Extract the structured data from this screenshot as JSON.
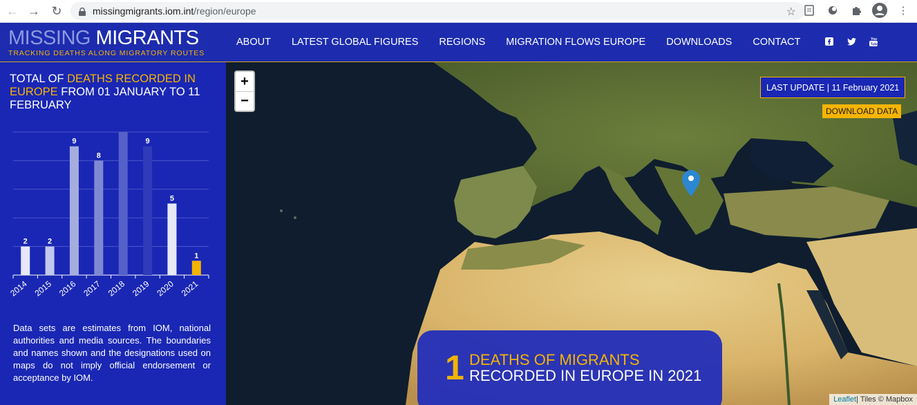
{
  "browser": {
    "url_host": "missingmigrants.iom.int",
    "url_path": "/region/europe"
  },
  "header": {
    "logo_part1": "MISSING",
    "logo_part2": "MIGRANTS",
    "logo_tagline": "TRACKING DEATHS ALONG MIGRATORY ROUTES",
    "menu": [
      {
        "label": "ABOUT"
      },
      {
        "label": "LATEST GLOBAL FIGURES"
      },
      {
        "label": "REGIONS"
      },
      {
        "label": "MIGRATION FLOWS EUROPE"
      },
      {
        "label": "DOWNLOADS"
      },
      {
        "label": "CONTACT"
      }
    ],
    "social_icons": [
      "facebook-icon",
      "twitter-icon",
      "youtube-icon"
    ]
  },
  "panel": {
    "title_a": "TOTAL OF ",
    "title_hl": "DEATHS RECORDED IN EUROPE",
    "title_b": " FROM 01 JANUARY TO 11 FEBRUARY",
    "note": "Data sets are estimates from IOM, national authorities and media sources. The boundaries and names shown and the designations used on maps do not imply official endorsement or acceptance by IOM."
  },
  "chart_data": {
    "type": "bar",
    "categories": [
      "2014",
      "2015",
      "2016",
      "2017",
      "2018",
      "2019",
      "2020",
      "2021"
    ],
    "values": [
      2,
      2,
      9,
      8,
      10,
      9,
      5,
      1
    ],
    "colors": [
      "#e6e8f7",
      "#c2c7ee",
      "#a5addf",
      "#7f89d3",
      "#5560c9",
      "#2f3bb8",
      "#e6e8f7",
      "#f5b400"
    ],
    "ylim": [
      0,
      10
    ],
    "grid": true,
    "title": "",
    "xlabel": "",
    "ylabel": ""
  },
  "map": {
    "zoom_in": "+",
    "zoom_out": "−",
    "last_update": "LAST UPDATE | 11 February 2021",
    "download": "DOWNLOAD DATA",
    "deaths_number": "1",
    "deaths_line1": "DEATHS OF MIGRANTS",
    "deaths_line2": "RECORDED IN EUROPE IN 2021",
    "attr_leaflet": "Leaflet",
    "attr_tiles": " | Tiles © Mapbox"
  },
  "colors": {
    "brand_blue": "#1a27b4",
    "accent_yellow": "#f5b400"
  }
}
